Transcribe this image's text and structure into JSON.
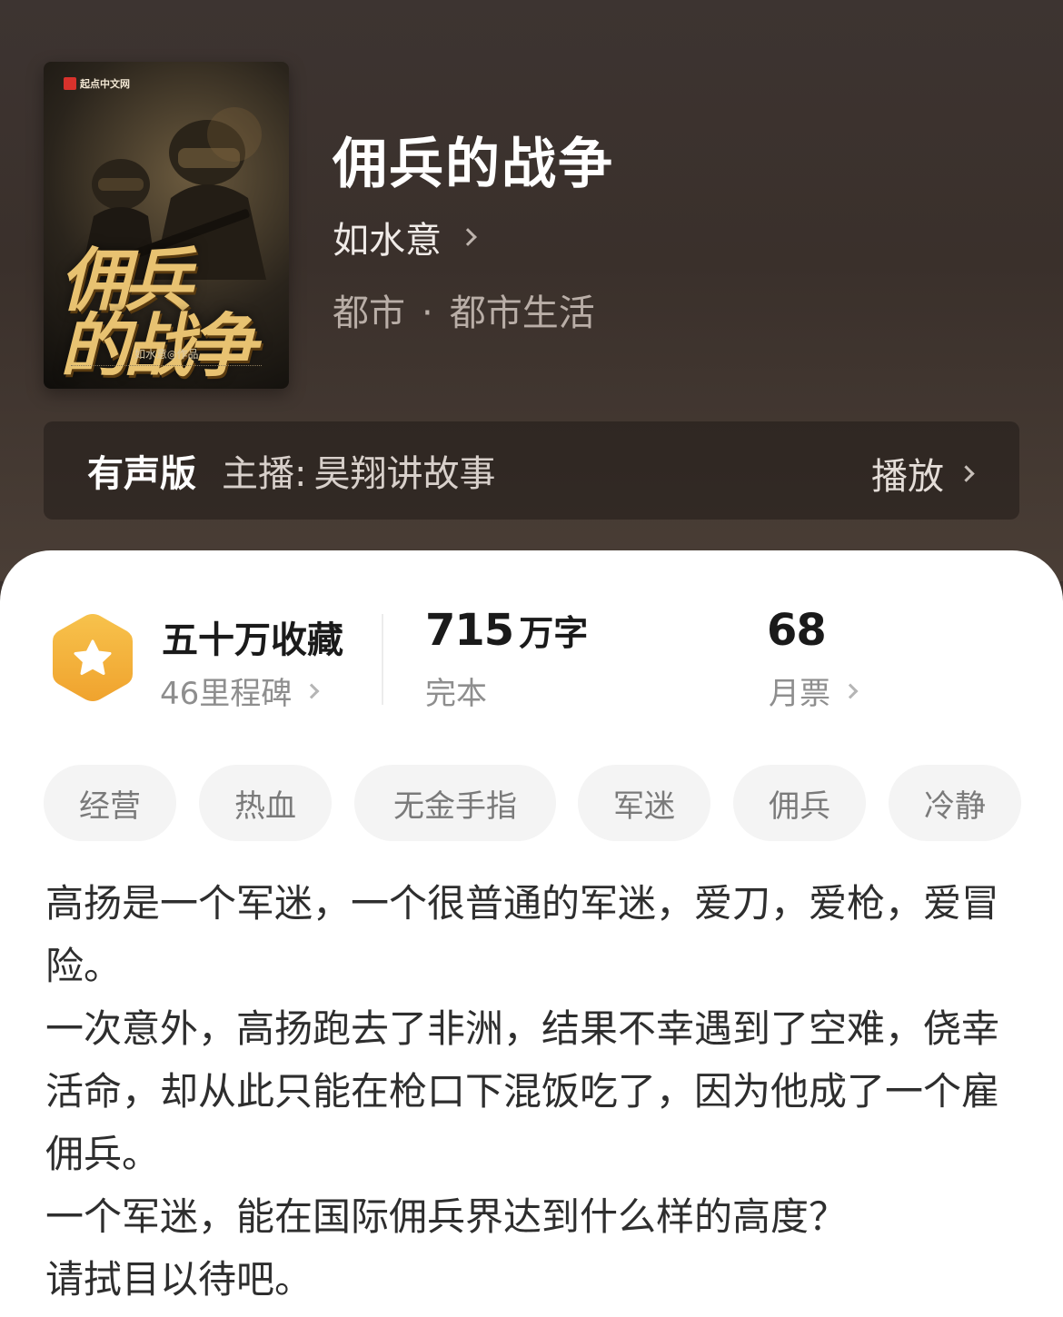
{
  "cover": {
    "publisher": "起点中文网",
    "title_lines": [
      "佣兵",
      "的战争"
    ],
    "author_credit": "如水意◎作品"
  },
  "book": {
    "title": "佣兵的战争",
    "author": "如水意",
    "genre_main": "都市",
    "genre_separator": "·",
    "genre_sub": "都市生活"
  },
  "audio": {
    "label": "有声版",
    "anchor_label": "主播:",
    "anchor_name": "昊翔讲故事",
    "play_label": "播放"
  },
  "stats": {
    "collection": {
      "title": "五十万收藏",
      "sub": "46里程碑"
    },
    "words": {
      "number": "715",
      "unit": "万字",
      "sub": "完本"
    },
    "monthly": {
      "number": "68",
      "sub": "月票"
    }
  },
  "tags": [
    "经营",
    "热血",
    "无金手指",
    "军迷",
    "佣兵",
    "冷静"
  ],
  "synopsis": [
    "高扬是一个军迷，一个很普通的军迷，爱刀，爱枪，爱冒险。",
    "一次意外，高扬跑去了非洲，结果不幸遇到了空难，侥幸活命，却从此只能在枪口下混饭吃了，因为他成了一个雇佣兵。",
    "一个军迷，能在国际佣兵界达到什么样的高度？",
    "请拭目以待吧。"
  ],
  "colors": {
    "hero_bg": "#3a312d",
    "badge_gold": "#f3b43e",
    "tag_bg": "#f4f4f4"
  },
  "icons": {
    "badge": "star-hexagon-icon",
    "chevron": "chevron-right-icon"
  }
}
